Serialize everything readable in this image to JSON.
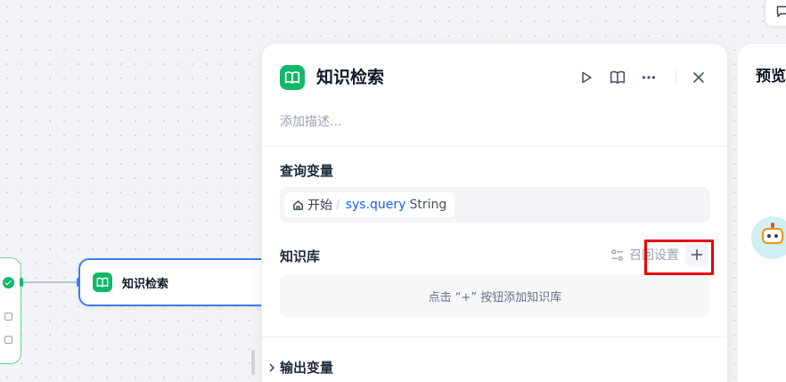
{
  "canvas": {
    "knowledge_node": {
      "title": "知识检索"
    }
  },
  "panel": {
    "title": "知识检索",
    "description_placeholder": "添加描述...",
    "query_section": {
      "label": "查询变量",
      "variable": {
        "node": "开始",
        "separator": "/",
        "name": "sys.query",
        "type": "String"
      }
    },
    "kb_section": {
      "label": "知识库",
      "recall_settings_label": "召回设置",
      "add_symbol": "+",
      "empty_hint": "点击 “+” 按钮添加知识库"
    },
    "output_section": {
      "label": "输出变量"
    }
  },
  "preview": {
    "title": "预览"
  },
  "colors": {
    "accent_green": "#12b76a",
    "selected_border": "#3f7bf2",
    "variable_blue": "#155eef",
    "highlight_red": "#e60000"
  },
  "icons": [
    "check-circle-icon",
    "book-open-icon",
    "play-icon",
    "more-icon",
    "close-icon",
    "home-icon",
    "recall-settings-icon",
    "plus-icon",
    "chevron-right-icon",
    "robot-icon",
    "feedback-icon"
  ]
}
